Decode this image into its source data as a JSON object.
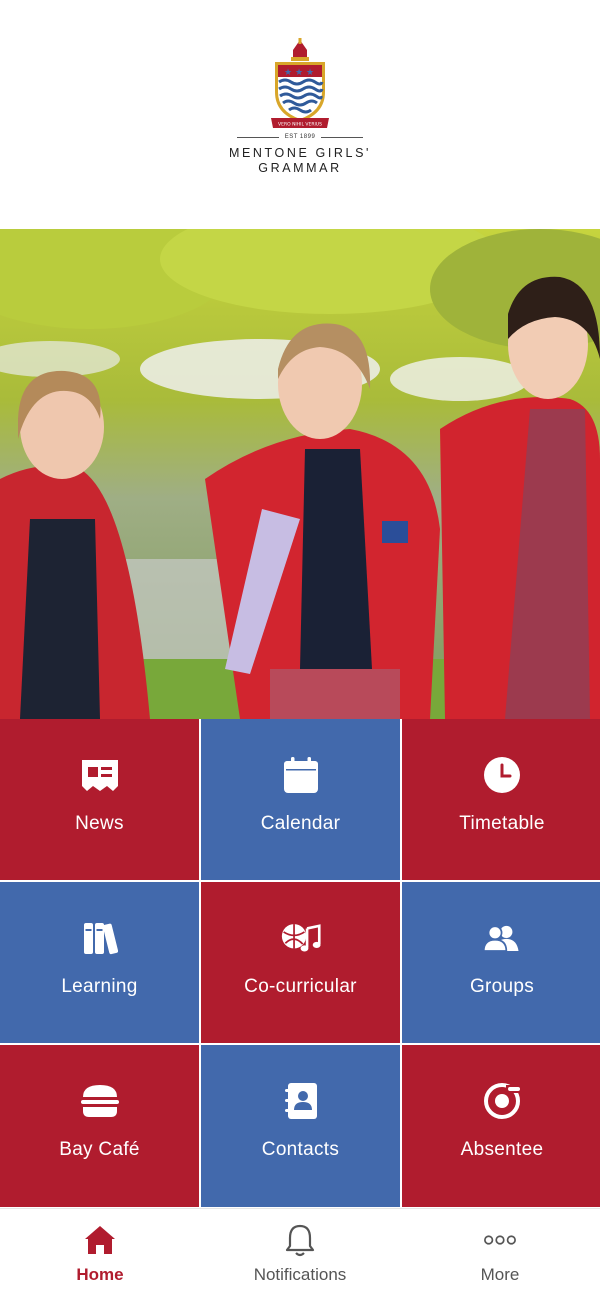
{
  "header": {
    "est": "EST 1899",
    "motto": "VERO NIHIL VERIUS",
    "name_line1": "MENTONE GIRLS'",
    "name_line2": "GRAMMAR"
  },
  "tiles": [
    {
      "label": "News",
      "icon": "newspaper-icon"
    },
    {
      "label": "Calendar",
      "icon": "calendar-icon"
    },
    {
      "label": "Timetable",
      "icon": "clock-icon"
    },
    {
      "label": "Learning",
      "icon": "books-icon"
    },
    {
      "label": "Co-curricular",
      "icon": "sports-music-icon"
    },
    {
      "label": "Groups",
      "icon": "users-icon"
    },
    {
      "label": "Bay Café",
      "icon": "burger-icon"
    },
    {
      "label": "Contacts",
      "icon": "address-book-icon"
    },
    {
      "label": "Absentee",
      "icon": "absentee-icon"
    }
  ],
  "tabs": [
    {
      "label": "Home",
      "icon": "home-icon",
      "active": true
    },
    {
      "label": "Notifications",
      "icon": "bell-icon",
      "active": false
    },
    {
      "label": "More",
      "icon": "more-dots-icon",
      "active": false
    }
  ],
  "colors": {
    "red": "#b01c2e",
    "blue": "#4269ac",
    "white": "#ffffff",
    "active_tab": "#b01c2e"
  }
}
